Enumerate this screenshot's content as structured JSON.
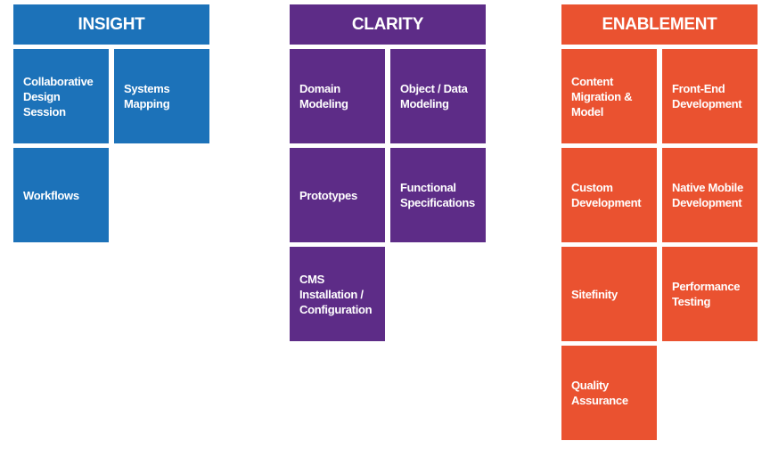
{
  "columns": [
    {
      "title": "INSIGHT",
      "color": "#1c72b9",
      "tiles": [
        "Collaborative Design Session",
        "Systems Mapping",
        "Workflows"
      ]
    },
    {
      "title": "CLARITY",
      "color": "#5d2c87",
      "tiles": [
        "Domain Modeling",
        "Object / Data Modeling",
        "Prototypes",
        "Functional Specifications",
        "CMS Installation / Configuration"
      ]
    },
    {
      "title": "ENABLEMENT",
      "color": "#ea5230",
      "tiles": [
        "Content Migration & Model",
        "Front-End Development",
        "Custom Development",
        "Native Mobile Development",
        "Sitefinity",
        "Performance Testing",
        "Quality Assurance"
      ]
    }
  ]
}
